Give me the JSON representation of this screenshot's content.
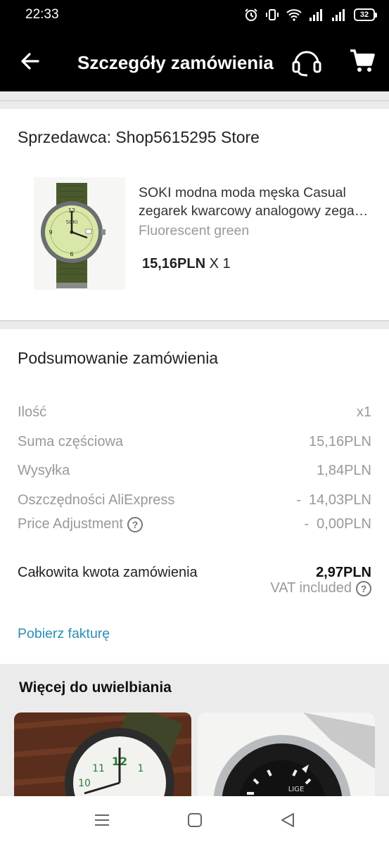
{
  "status_bar": {
    "time": "22:33",
    "battery": "32"
  },
  "app_bar": {
    "title": "Szczegóły zamówienia"
  },
  "seller": {
    "label": "Sprzedawca: Shop5615295 Store"
  },
  "product": {
    "title_line1": "SOKI modna moda męska Casual",
    "title_line2": "zegarek kwarcowy analogowy zegarek",
    "variant": "Fluorescent green",
    "price": "15,16PLN",
    "quantity": "X 1",
    "watch_brand": "SOKI"
  },
  "summary": {
    "title": "Podsumowanie zamówienia",
    "rows": [
      {
        "label": "Ilość",
        "value": "x1"
      },
      {
        "label": "Suma częściowa",
        "value": "15,16PLN"
      },
      {
        "label": "Wysyłka",
        "value": "1,84PLN"
      },
      {
        "label": "Oszczędności AliExpress",
        "value": "-  14,03PLN"
      },
      {
        "label": "Price Adjustment",
        "value": "-  0,00PLN"
      }
    ],
    "help_glyph": "?",
    "total_label": "Całkowita kwota zamówienia",
    "total_value": "2,97PLN",
    "vat": "VAT included",
    "invoice_link": "Pobierz fakturę"
  },
  "recommendations": {
    "title": "Więcej do uwielbiania",
    "second_brand": "LIGE"
  },
  "colors": {
    "link": "#2a8fb3",
    "app_bar": "#000000",
    "muted_text": "#999999"
  }
}
